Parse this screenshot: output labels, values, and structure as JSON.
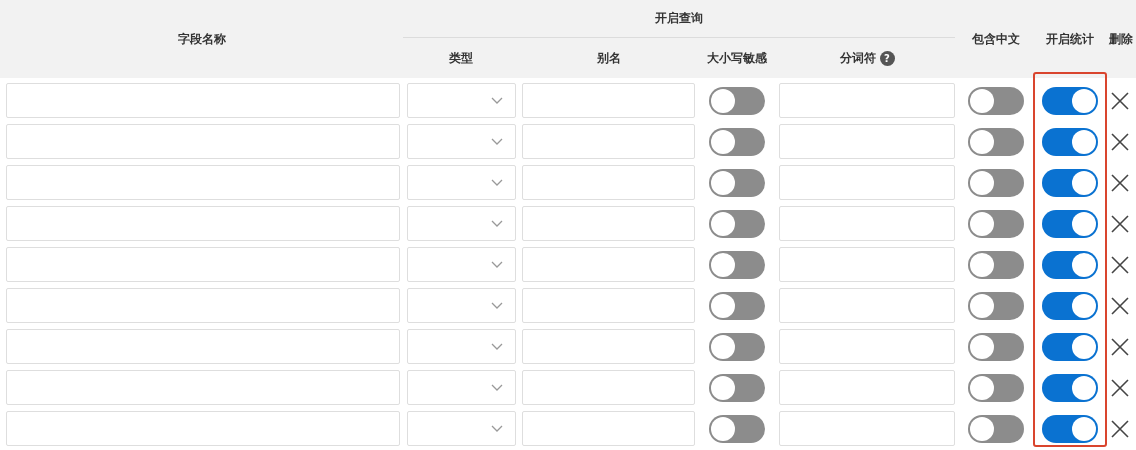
{
  "header": {
    "field_name": "字段名称",
    "query_group": "开启查询",
    "type": "类型",
    "alias": "别名",
    "case_sensitive": "大小写敏感",
    "separator": "分词符",
    "separator_help": "?",
    "chinese": "包含中文",
    "stats": "开启统计",
    "delete": "删除"
  },
  "stats_column_highlighted": true,
  "rows": [
    {
      "case_sensitive": false,
      "chinese": false,
      "stats": true
    },
    {
      "case_sensitive": false,
      "chinese": false,
      "stats": true
    },
    {
      "case_sensitive": false,
      "chinese": false,
      "stats": true
    },
    {
      "case_sensitive": false,
      "chinese": false,
      "stats": true
    },
    {
      "case_sensitive": false,
      "chinese": false,
      "stats": true
    },
    {
      "case_sensitive": false,
      "chinese": false,
      "stats": true
    },
    {
      "case_sensitive": false,
      "chinese": false,
      "stats": true
    },
    {
      "case_sensitive": false,
      "chinese": false,
      "stats": true
    },
    {
      "case_sensitive": false,
      "chinese": false,
      "stats": true
    }
  ]
}
